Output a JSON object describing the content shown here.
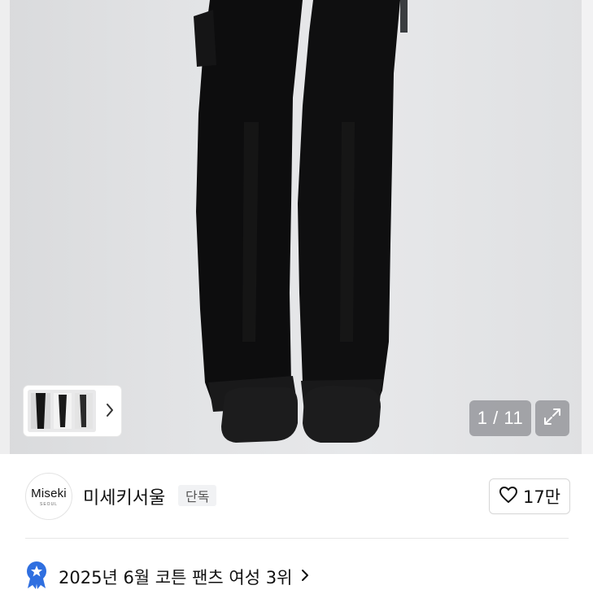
{
  "gallery": {
    "counter": "1 / 11",
    "expand_icon": "expand-icon",
    "next_icon": "chevron-right-icon"
  },
  "brand": {
    "logo_text": "Miseki",
    "logo_subtext": "SEOUL",
    "name": "미세키서울",
    "badge": "단독"
  },
  "like": {
    "icon": "heart-icon",
    "count": "17만"
  },
  "ranking": {
    "icon": "ribbon-badge-icon",
    "text": "2025년 6월 코튼 팬츠 여성 3위",
    "accent_color": "#2f6fe0"
  }
}
